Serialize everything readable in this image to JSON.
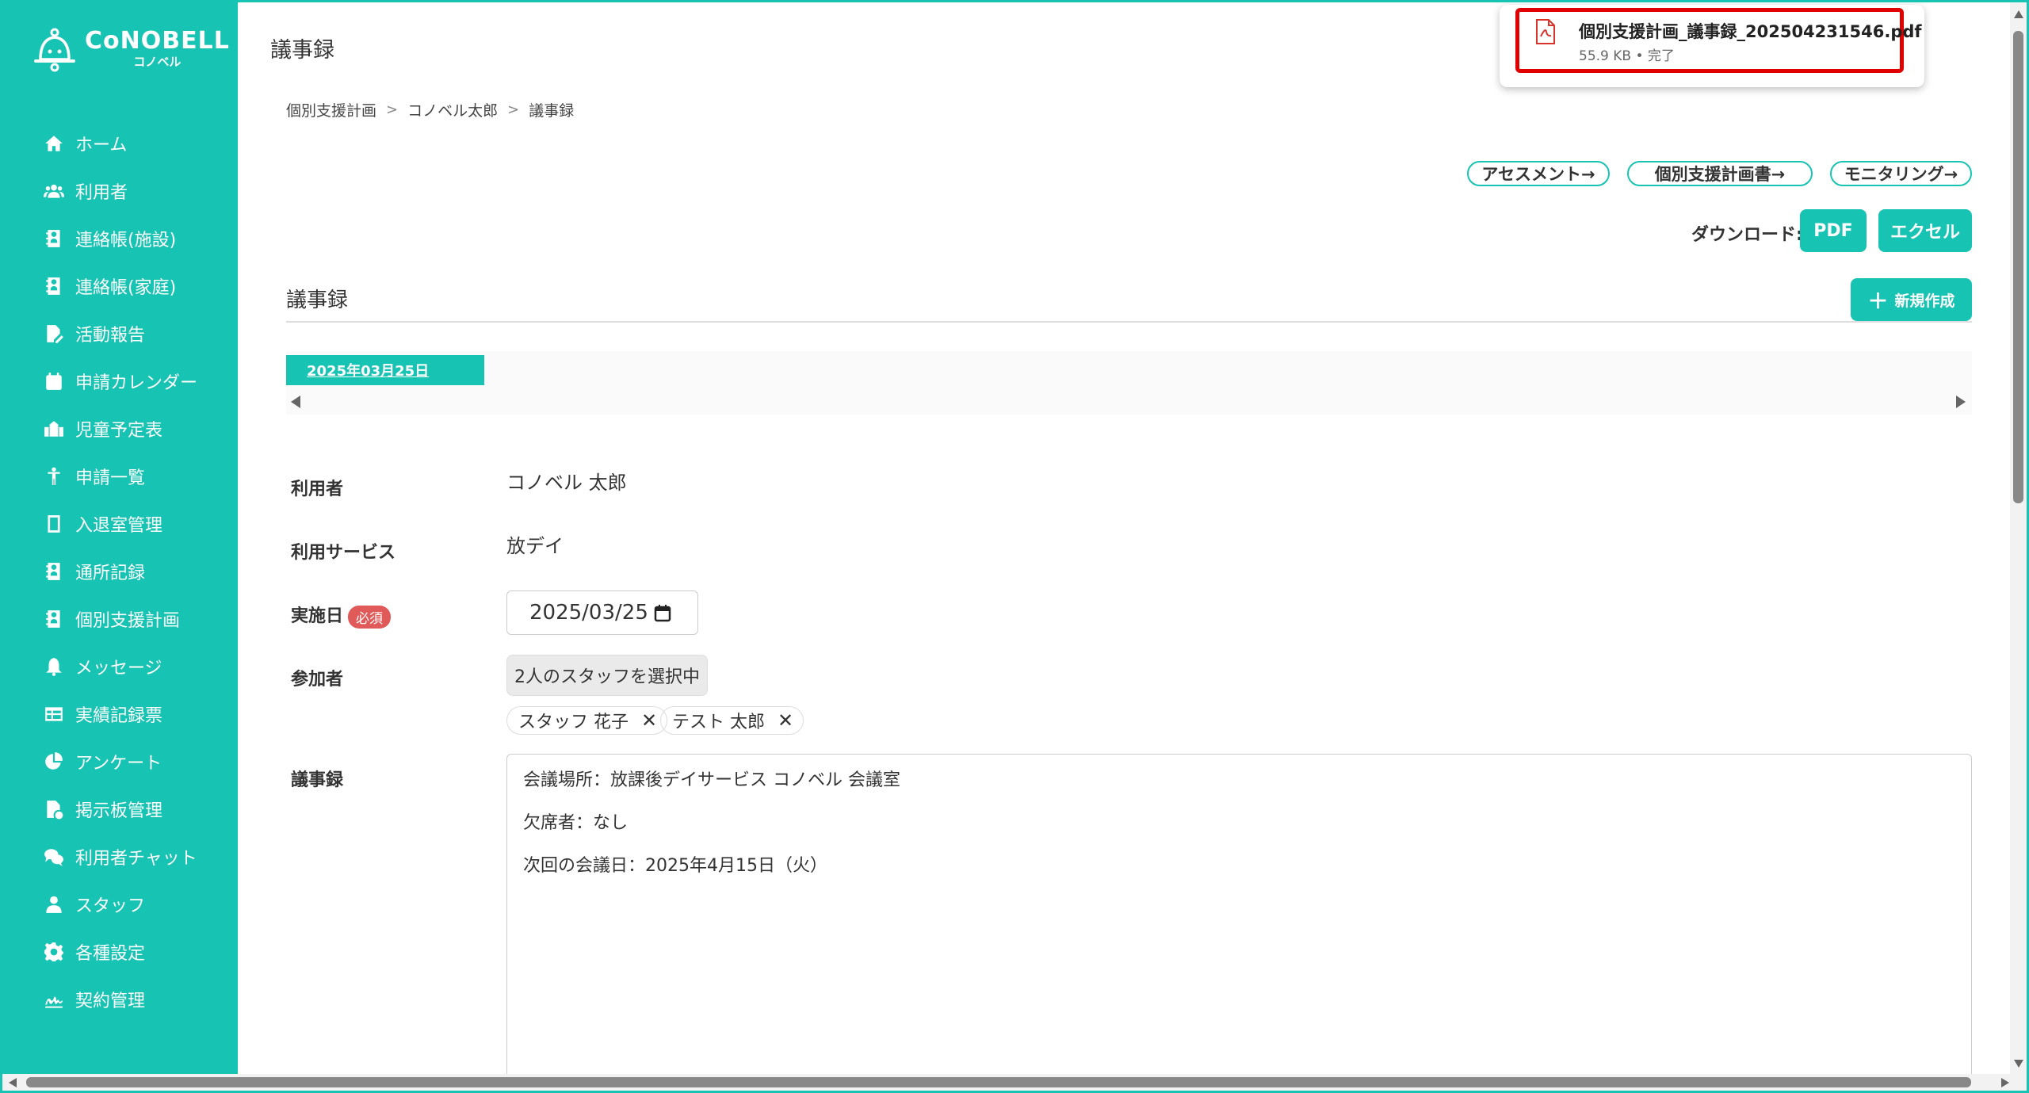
{
  "brand": {
    "name": "CoNOBELL",
    "sub": "コノベル"
  },
  "sidebar": {
    "items": [
      {
        "label": "ホーム",
        "icon": "home-icon"
      },
      {
        "label": "利用者",
        "icon": "users-icon"
      },
      {
        "label": "連絡帳(施設)",
        "icon": "contact-book-icon"
      },
      {
        "label": "連絡帳(家庭)",
        "icon": "contact-book-icon"
      },
      {
        "label": "活動報告",
        "icon": "file-edit-icon"
      },
      {
        "label": "申請カレンダー",
        "icon": "calendar-icon"
      },
      {
        "label": "児童予定表",
        "icon": "school-icon"
      },
      {
        "label": "申請一覧",
        "icon": "child-icon"
      },
      {
        "label": "入退室管理",
        "icon": "tablet-icon"
      },
      {
        "label": "通所記録",
        "icon": "contact-book-icon"
      },
      {
        "label": "個別支援計画",
        "icon": "contact-book-icon"
      },
      {
        "label": "メッセージ",
        "icon": "bell-icon"
      },
      {
        "label": "実績記録票",
        "icon": "table-icon"
      },
      {
        "label": "アンケート",
        "icon": "pie-chart-icon"
      },
      {
        "label": "掲示板管理",
        "icon": "file-chart-icon"
      },
      {
        "label": "利用者チャット",
        "icon": "chat-icon"
      },
      {
        "label": "スタッフ",
        "icon": "staff-icon"
      },
      {
        "label": "各種設定",
        "icon": "gear-icon"
      },
      {
        "label": "契約管理",
        "icon": "signature-icon"
      }
    ]
  },
  "header": {
    "title": "議事録"
  },
  "breadcrumb": [
    "個別支援計画",
    "コノベル太郎",
    "議事録"
  ],
  "links": {
    "assessment": "アセスメント→",
    "plan": "個別支援計画書→",
    "monitoring": "モニタリング→"
  },
  "download": {
    "label": "ダウンロード:",
    "pdf": "PDF",
    "excel": "エクセル"
  },
  "section": {
    "title": "議事録",
    "new_button": "新規作成"
  },
  "tabs": {
    "active_date": "2025年03月25日"
  },
  "form": {
    "user_label": "利用者",
    "user_value": "コノベル 太郎",
    "service_label": "利用サービス",
    "service_value": "放デイ",
    "date_label": "実施日",
    "required_badge": "必須",
    "date_value": "2025/03/25",
    "participants_label": "参加者",
    "participants_select": "2人のスタッフを選択中",
    "participants": [
      "スタッフ 花子",
      "テスト 太郎"
    ],
    "minutes_label": "議事録",
    "minutes_lines": [
      "会議場所：放課後デイサービス コノベル 会議室",
      "欠席者：なし",
      "次回の会議日：2025年4月15日（火）"
    ]
  },
  "download_popup": {
    "filename": "個別支援計画_議事録_202504231546.pdf",
    "meta": "55.9 KB • 完了"
  },
  "colors": {
    "accent": "#17c3b2",
    "required": "#e05a5a",
    "highlight": "#e00000"
  }
}
